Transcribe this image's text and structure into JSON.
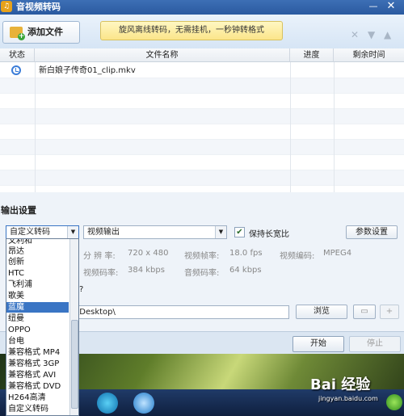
{
  "window": {
    "title": "音视频转码",
    "close_glyph": "✕",
    "min_glyph": "—"
  },
  "toolbar": {
    "add_file_label": "添加文件",
    "promo_text": "旋风离线转码，无需挂机，一秒钟转格式"
  },
  "file_table": {
    "columns": [
      "状态",
      "文件名称",
      "进度",
      "剩余时间"
    ],
    "rows": [
      {
        "status_icon": "clock-icon",
        "filename": "新白娘子传奇01_clip.mkv",
        "progress": "",
        "remaining": ""
      }
    ]
  },
  "output_settings": {
    "title": "输出设置",
    "format_selected": "自定义转码",
    "mode_selected": "视频输出",
    "keep_aspect_label": "保持长宽比",
    "keep_aspect_checked": true,
    "params_button": "参数设置",
    "resolution_label": "分 辨 率:",
    "resolution_value": "720 x 480",
    "framerate_label": "视频帧率:",
    "framerate_value": "18.0 fps",
    "codec_label": "视频编码:",
    "codec_value": "MPEG4",
    "vbitrate_label": "视频码率:",
    "vbitrate_value": "384 kbps",
    "abitrate_label": "音频码率:",
    "abitrate_value": "64 kbps",
    "partial_label": "型?",
    "output_path": ")\\Desktop\\",
    "browse_label": "浏览"
  },
  "actions": {
    "start_label": "开始",
    "stop_label": "停止"
  },
  "dropdown": {
    "items": [
      "文利和",
      "昂达",
      "创新",
      "HTC",
      "飞利浦",
      "歌美",
      "蓝魔",
      "纽曼",
      "OPPO",
      "台电",
      "兼容格式 MP4",
      "兼容格式 3GP",
      "兼容格式 AVI",
      "兼容格式 DVD",
      "H264高清",
      "自定义转码"
    ],
    "highlighted_index": 6
  },
  "watermark": {
    "main": "Bai 经验",
    "sub": "jingyan.baidu.com"
  }
}
